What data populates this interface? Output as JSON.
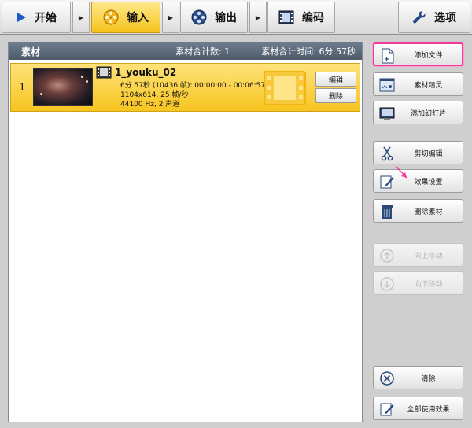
{
  "toolbar": {
    "tabs": [
      {
        "label": "开始",
        "icon": "play-icon"
      },
      {
        "label": "输入",
        "icon": "film-reel-icon",
        "active": true
      },
      {
        "label": "输出",
        "icon": "reel-output-icon"
      },
      {
        "label": "编码",
        "icon": "film-strip-icon"
      }
    ],
    "options_label": "选项",
    "options_icon": "wrench-icon"
  },
  "panel": {
    "title": "素材",
    "count_text": "素材合计数: 1",
    "time_text": "素材合计时间: 6分 57秒"
  },
  "item": {
    "index": "1",
    "name": "1_youku_02",
    "line1": "6分 57秒 (10436 帧): 00:00:00 - 00:06:57",
    "line2": "1104x614, 25 帧/秒",
    "line3": "44100 Hz, 2 声道",
    "edit_label": "编辑",
    "delete_label": "删除"
  },
  "side_buttons": {
    "add_file": "添加文件",
    "material_wizard": "素材精灵",
    "add_slideshow": "添加幻灯片",
    "cut_edit": "剪切编辑",
    "effect_settings": "效果设置",
    "delete_material": "删除素材",
    "move_up": "向上移动",
    "move_down": "向下移动",
    "clear": "清除",
    "apply_all_effects": "全部使用效果"
  },
  "colors": {
    "active_tab": "#f4c21a",
    "highlight_border": "#f33a9a",
    "panel_header": "#4c5a6a"
  }
}
